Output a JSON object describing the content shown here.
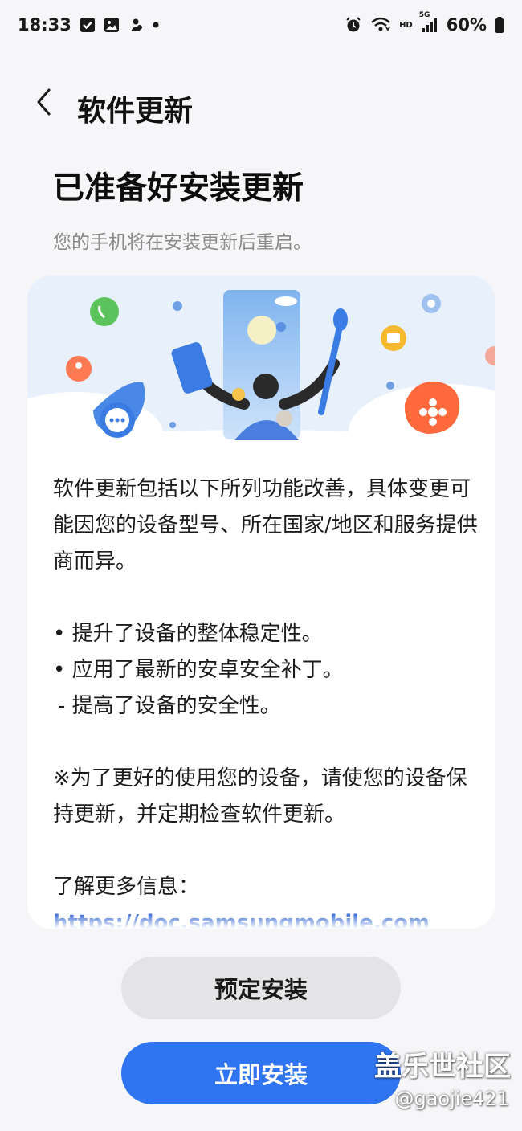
{
  "status_bar": {
    "time": "18:33",
    "network": "HD",
    "signal": "5G",
    "battery": "60%",
    "left_icons": [
      "checkbox-notification-icon",
      "gallery-notification-icon",
      "app-notification-icon",
      "dot-icon"
    ],
    "right_icons": [
      "alarm-icon",
      "wifi-icon",
      "signal-icon",
      "battery-icon"
    ]
  },
  "header": {
    "title": "软件更新",
    "back_icon": "chevron-left-icon"
  },
  "main": {
    "heading": "已准备好安装更新",
    "subtext": "您的手机将在安装更新后重启。"
  },
  "card": {
    "intro": "软件更新包括以下所列功能改善，具体变更可能因您的设备型号、所在国家/地区和服务提供商而异。",
    "bullets": [
      "• 提升了设备的整体稳定性。",
      "• 应用了最新的安卓安全补丁。",
      " - 提高了设备的安全性。"
    ],
    "note": "※为了更好的使用您的设备，请使您的设备保持更新，并定期检查软件更新。",
    "more_info_label": "了解更多信息：",
    "link_partial": "https://doc.samsungmobile.com"
  },
  "buttons": {
    "schedule": "预定安装",
    "install_now": "立即安装"
  },
  "watermark": {
    "title": "盖乐世社区",
    "user": "@gaojie421"
  },
  "colors": {
    "background": "#f6f6f8",
    "primary_button": "#2f74f0",
    "secondary_button": "#e4e4e7",
    "link": "#2b61d1"
  }
}
